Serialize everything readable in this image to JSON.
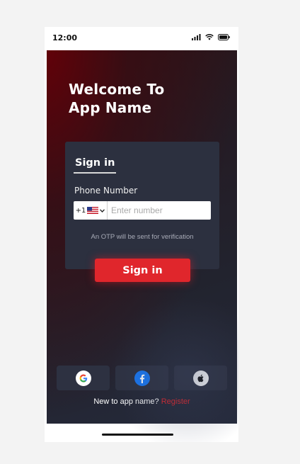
{
  "status_bar": {
    "time": "12:00",
    "icons": [
      "signal-icon",
      "wifi-icon",
      "battery-icon"
    ]
  },
  "welcome": {
    "heading": "Welcome To\nApp Name"
  },
  "signin_card": {
    "title": "Sign in",
    "phone_label": "Phone Number",
    "country_code": "+1",
    "country_flag": "us-flag-icon",
    "number_placeholder": "Enter number",
    "number_value": "",
    "otp_note": "An OTP will be sent for verification",
    "button_label": "Sign in"
  },
  "social": [
    "google-icon",
    "facebook-icon",
    "apple-icon"
  ],
  "footer": {
    "prompt": "New to app name?",
    "register_label": "Register"
  },
  "colors": {
    "accent": "#e0262c",
    "card": "#2c303f",
    "social_button": "#2d3141",
    "background_top": "#5a0a10",
    "background_bottom": "#252a3b"
  }
}
